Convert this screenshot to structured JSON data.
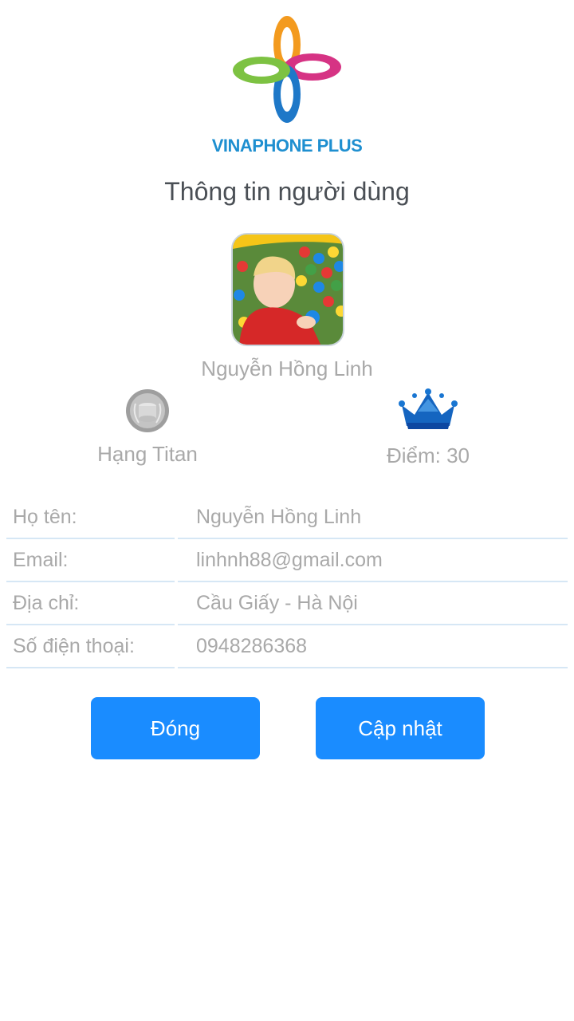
{
  "brand": {
    "name": "VINAPHONE PLUS",
    "color": "#1e8fd0"
  },
  "page": {
    "title": "Thông tin người dùng"
  },
  "user": {
    "display_name": "Nguyễn Hồng Linh",
    "rank_label": "Hạng Titan",
    "points_label": "Điểm: 30",
    "rank_icon": "silver-medal-icon",
    "points_icon": "crown-icon"
  },
  "info": {
    "rows": [
      {
        "label": "Họ tên:",
        "value": "Nguyễn Hồng Linh"
      },
      {
        "label": "Email:",
        "value": "linhnh88@gmail.com"
      },
      {
        "label": "Địa chỉ:",
        "value": "Cầu Giấy - Hà Nội"
      },
      {
        "label": "Số điện thoại:",
        "value": "0948286368"
      }
    ]
  },
  "buttons": {
    "close_label": "Đóng",
    "update_label": "Cập nhật",
    "color": "#1a8cff"
  }
}
